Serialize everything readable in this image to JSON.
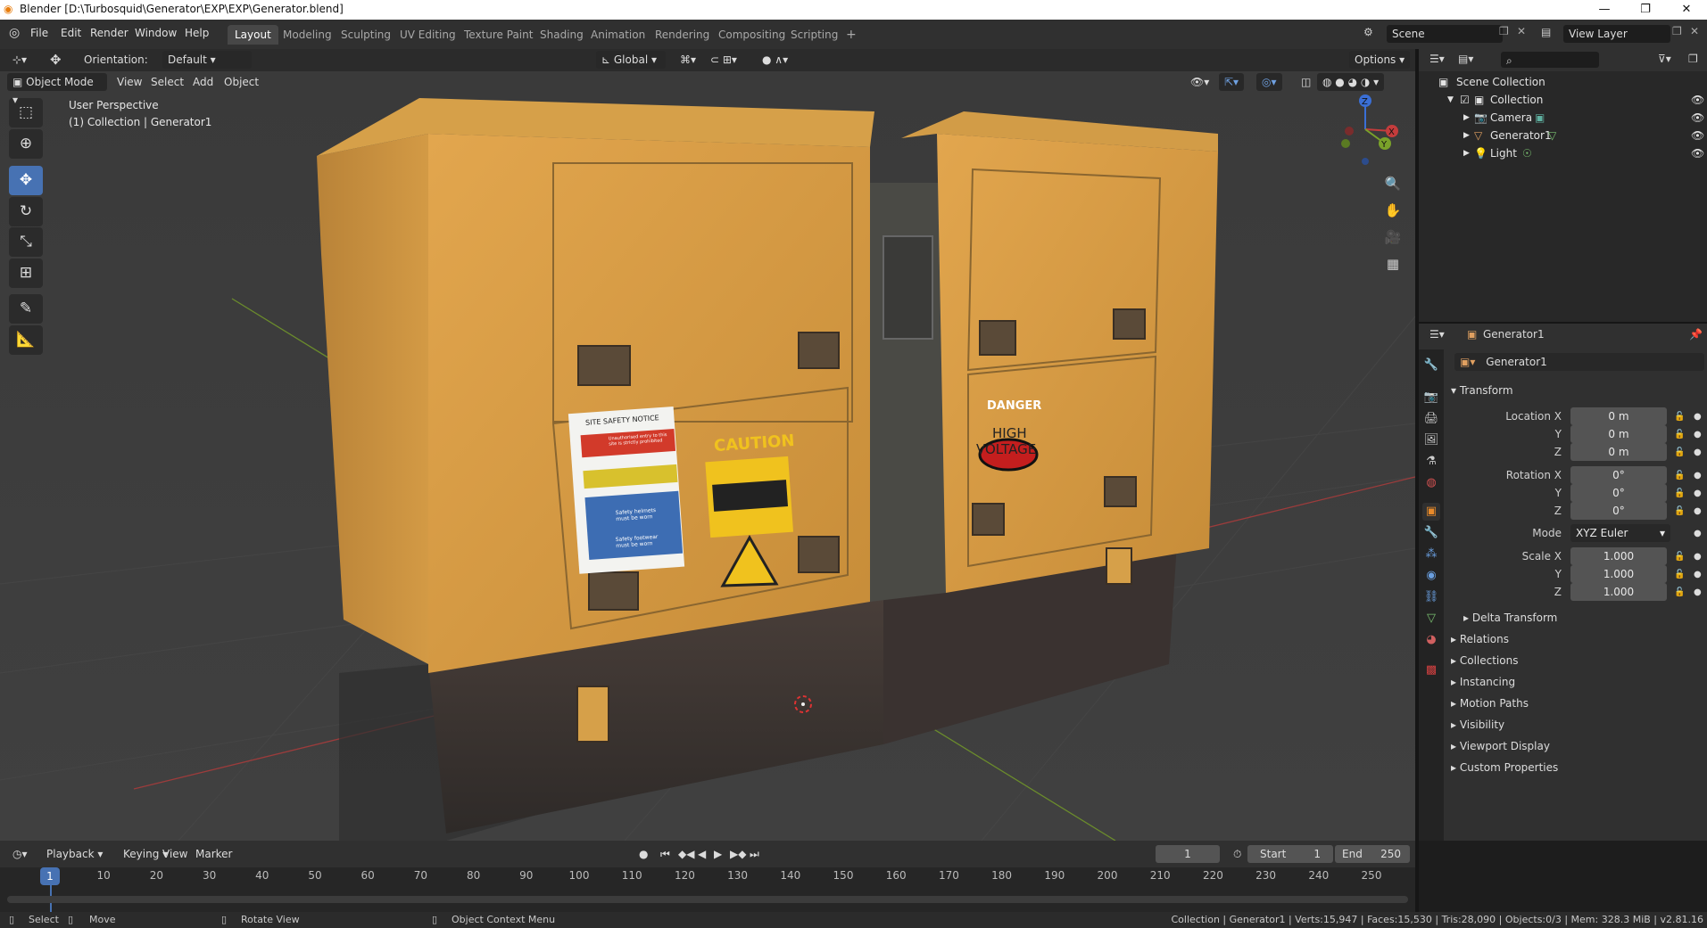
{
  "window": {
    "title": "Blender [D:\\Turbosquid\\Generator\\EXP\\EXP\\Generator.blend]",
    "minimize": "—",
    "restore": "❐",
    "close": "✕"
  },
  "menubar": {
    "items": [
      "File",
      "Edit",
      "Render",
      "Window",
      "Help"
    ],
    "workspaces": [
      "Layout",
      "Modeling",
      "Sculpting",
      "UV Editing",
      "Texture Paint",
      "Shading",
      "Animation",
      "Rendering",
      "Compositing",
      "Scripting"
    ],
    "add_workspace": "+",
    "scene": "Scene",
    "view_layer": "View Layer"
  },
  "viewport": {
    "orientation_label": "Orientation:",
    "orientation_value": "Default",
    "transform_space": "Global",
    "options": "Options",
    "mode": "Object Mode",
    "menus": [
      "View",
      "Select",
      "Add",
      "Object"
    ],
    "perspective_label": "User Perspective",
    "collection_label": "(1) Collection | Generator1",
    "axes": {
      "x": "X",
      "y": "Y",
      "z": "Z"
    },
    "labels_on_model": {
      "sign_title": "SITE SAFETY NOTICE",
      "sign_line1": "Unauthorised entry to this site is strictly prohibited",
      "sign_line2": "Safety helmets must be worn",
      "sign_line3": "Safety footwear must be worn",
      "caution": "CAUTION",
      "danger": "DANGER",
      "high_voltage_1": "HIGH",
      "high_voltage_2": "VOLTAGE"
    }
  },
  "outliner": {
    "scene_collection": "Scene Collection",
    "items": [
      {
        "label": "Collection"
      },
      {
        "label": "Camera"
      },
      {
        "label": "Generator1"
      },
      {
        "label": "Light"
      }
    ]
  },
  "properties": {
    "object_name": "Generator1",
    "object_field": "Generator1",
    "transform_header": "Transform",
    "location_label": "Location X",
    "y_label": "Y",
    "z_label": "Z",
    "location": [
      "0 m",
      "0 m",
      "0 m"
    ],
    "rotation_label": "Rotation X",
    "rotation": [
      "0°",
      "0°",
      "0°"
    ],
    "mode_label": "Mode",
    "mode_value": "XYZ Euler",
    "scale_label": "Scale X",
    "scale": [
      "1.000",
      "1.000",
      "1.000"
    ],
    "delta": "Delta Transform",
    "panels": [
      "Relations",
      "Collections",
      "Instancing",
      "Motion Paths",
      "Visibility",
      "Viewport Display",
      "Custom Properties"
    ]
  },
  "timeline": {
    "menus": [
      "Playback",
      "Keying",
      "View",
      "Marker"
    ],
    "current_frame": "1",
    "start_label": "Start",
    "start_value": "1",
    "end_label": "End",
    "end_value": "250",
    "playhead": "1",
    "ticks": [
      "10",
      "20",
      "30",
      "40",
      "50",
      "60",
      "70",
      "80",
      "90",
      "100",
      "110",
      "120",
      "130",
      "140",
      "150",
      "160",
      "170",
      "180",
      "190",
      "200",
      "210",
      "220",
      "230",
      "240",
      "250"
    ]
  },
  "statusbar": {
    "select": "Select",
    "move": "Move",
    "rotate": "Rotate View",
    "context": "Object Context Menu",
    "stats": "Collection | Generator1 | Verts:15,947 | Faces:15,530 | Tris:28,090 | Objects:0/3 | Mem: 328.3 MiB | v2.81.16"
  }
}
